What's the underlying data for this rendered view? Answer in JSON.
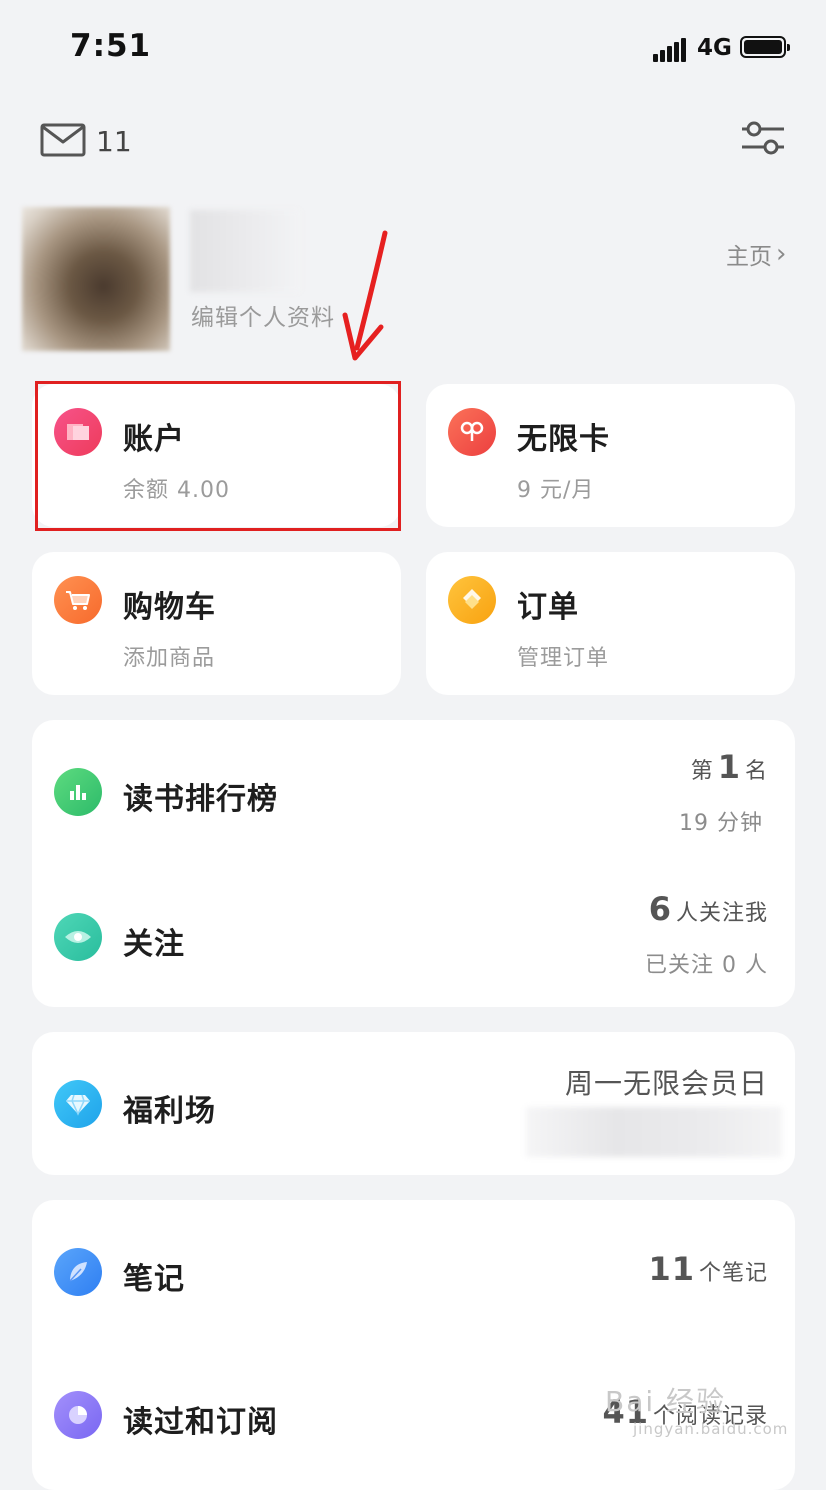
{
  "status_bar": {
    "time": "7:51",
    "network": "4G"
  },
  "top_bar": {
    "mail_count": "11"
  },
  "profile": {
    "edit_label": "编辑个人资料",
    "home_link": "主页"
  },
  "grid_cards": [
    {
      "title": "账户",
      "subtitle": "余额 4.00",
      "icon": "account-icon",
      "color": "#f0456b"
    },
    {
      "title": "无限卡",
      "subtitle": "9 元/月",
      "icon": "infinite-card-icon",
      "color": "#f25a45"
    },
    {
      "title": "购物车",
      "subtitle": "添加商品",
      "icon": "cart-icon",
      "color": "#fb7a3c"
    },
    {
      "title": "订单",
      "subtitle": "管理订单",
      "icon": "order-icon",
      "color": "#fbaa1f"
    }
  ],
  "ranking": {
    "title": "读书排行榜",
    "prefix": "第",
    "rank": "1",
    "suffix": "名",
    "time": "19 分钟"
  },
  "follow": {
    "title": "关注",
    "count": "6",
    "count_label": "人关注我",
    "following": "已关注 0 人"
  },
  "welfare": {
    "title": "福利场",
    "promo": "周一无限会员日"
  },
  "notes": {
    "title": "笔记",
    "count": "11",
    "count_label": "个笔记"
  },
  "reading": {
    "title": "读过和订阅",
    "count": "41",
    "count_label": "个阅读记录"
  },
  "watermark": {
    "top": "Bai 经验",
    "bottom": "jingyan.baidu.com"
  },
  "colors": {
    "background": "#f2f3f5",
    "card": "#ffffff",
    "highlight": "#e02020",
    "ranking_icon": "#3cc77a",
    "follow_icon": "#38c9a8",
    "welfare_icon": "#2db6f2",
    "notes_icon": "#3b8ef5",
    "reading_icon": "#8b7cf7"
  }
}
